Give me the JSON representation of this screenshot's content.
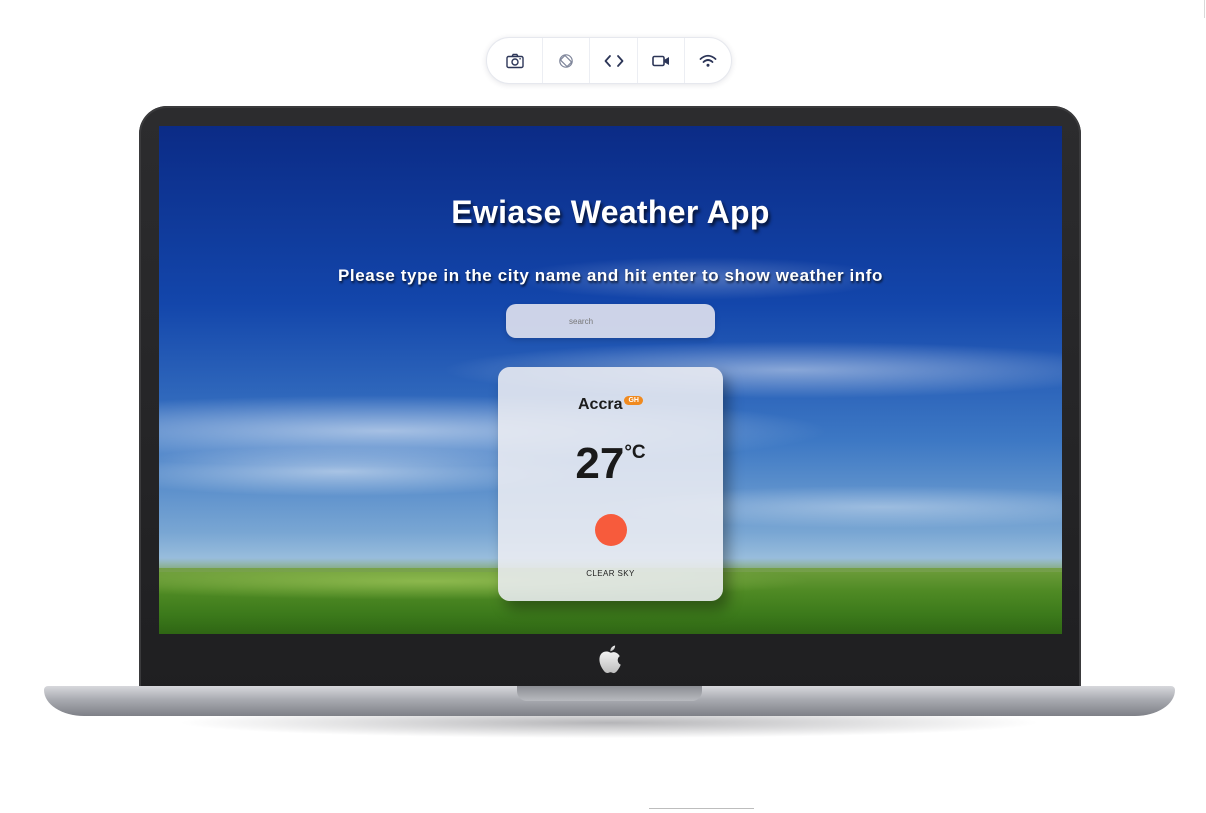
{
  "toolbar": {
    "buttons": [
      {
        "name": "screenshot",
        "icon": "camera-icon"
      },
      {
        "name": "rotate",
        "icon": "rotate-icon"
      },
      {
        "name": "code",
        "icon": "code-icon"
      },
      {
        "name": "record",
        "icon": "video-icon"
      },
      {
        "name": "network",
        "icon": "wifi-icon"
      }
    ]
  },
  "device": {
    "logo_icon": "apple-icon"
  },
  "app": {
    "title": "Ewiase Weather App",
    "subtitle": "Please type in the city name and hit enter to show weather info",
    "search": {
      "placeholder": "search",
      "value": ""
    },
    "card": {
      "city": "Accra",
      "country": "GH",
      "temperature": "27",
      "unit": "°C",
      "weather_icon": "sun-icon",
      "condition": "CLEAR SKY"
    }
  },
  "colors": {
    "sky_top": "#0b2b86",
    "sky_mid": "#1346ab",
    "grass": "#4f8a24",
    "badge": "#f08a1f",
    "sun": "#f75b3c",
    "toolbar_icon": "#2c3557"
  }
}
